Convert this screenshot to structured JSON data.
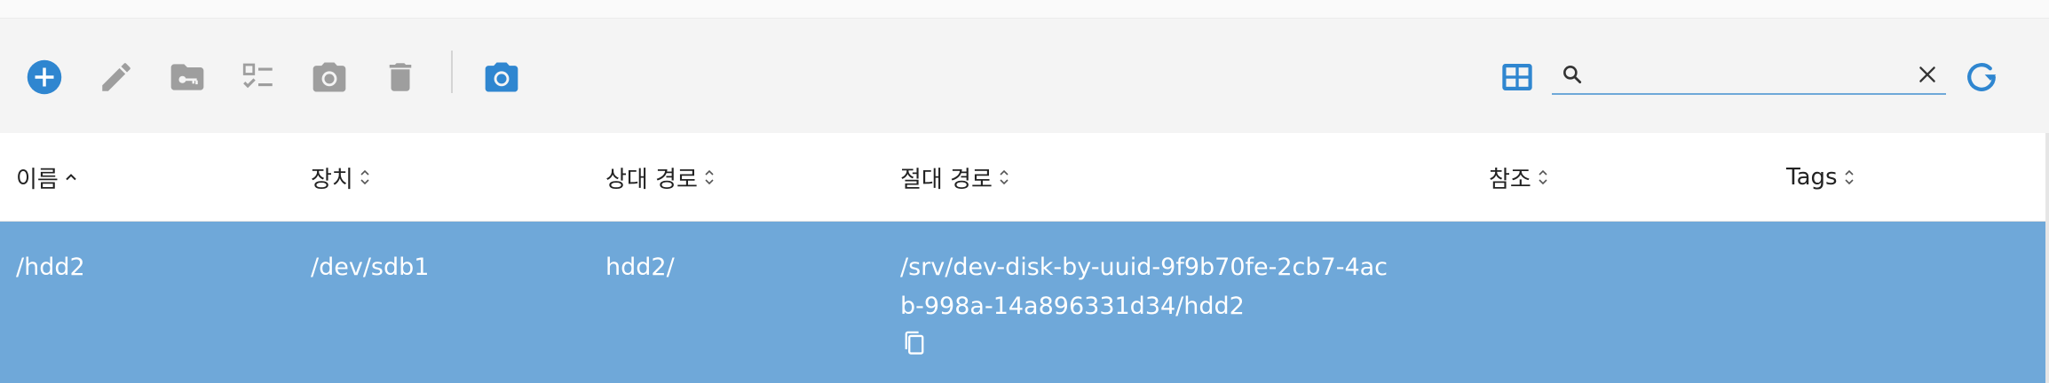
{
  "colors": {
    "accent": "#2f86d0",
    "icon_gray": "#9e9e9e",
    "row_selected": "#6fa8d9",
    "toolbar_bg": "#f4f4f4"
  },
  "toolbar": {
    "buttons": [
      {
        "name": "add",
        "icon": "plus-circle-icon"
      },
      {
        "name": "edit",
        "icon": "pencil-icon"
      },
      {
        "name": "permissions",
        "icon": "folder-key-icon"
      },
      {
        "name": "select",
        "icon": "checklist-icon"
      },
      {
        "name": "snapshot",
        "icon": "camera-icon"
      },
      {
        "name": "delete",
        "icon": "trash-icon"
      },
      {
        "name": "snapshots",
        "icon": "camera-icon"
      }
    ],
    "view_toggle_icon": "grid-view-icon",
    "refresh_icon": "refresh-icon"
  },
  "search": {
    "value": "",
    "placeholder": "",
    "icon": "search-icon",
    "clear_icon": "close-icon"
  },
  "table": {
    "columns": [
      {
        "label": "이름",
        "sort": "asc"
      },
      {
        "label": "장치",
        "sort": "none"
      },
      {
        "label": "상대 경로",
        "sort": "none"
      },
      {
        "label": "절대 경로",
        "sort": "none"
      },
      {
        "label": "참조",
        "sort": "none"
      },
      {
        "label": "Tags",
        "sort": "none"
      }
    ],
    "rows": [
      {
        "selected": true,
        "name": "/hdd2",
        "device": "/dev/sdb1",
        "relative_path": "hdd2/",
        "absolute_path": "/srv/dev-disk-by-uuid-9f9b70fe-2cb7-4acb-998a-14a896331d34/hdd2",
        "references": "",
        "tags": "",
        "copy_icon": "copy-icon"
      }
    ]
  }
}
